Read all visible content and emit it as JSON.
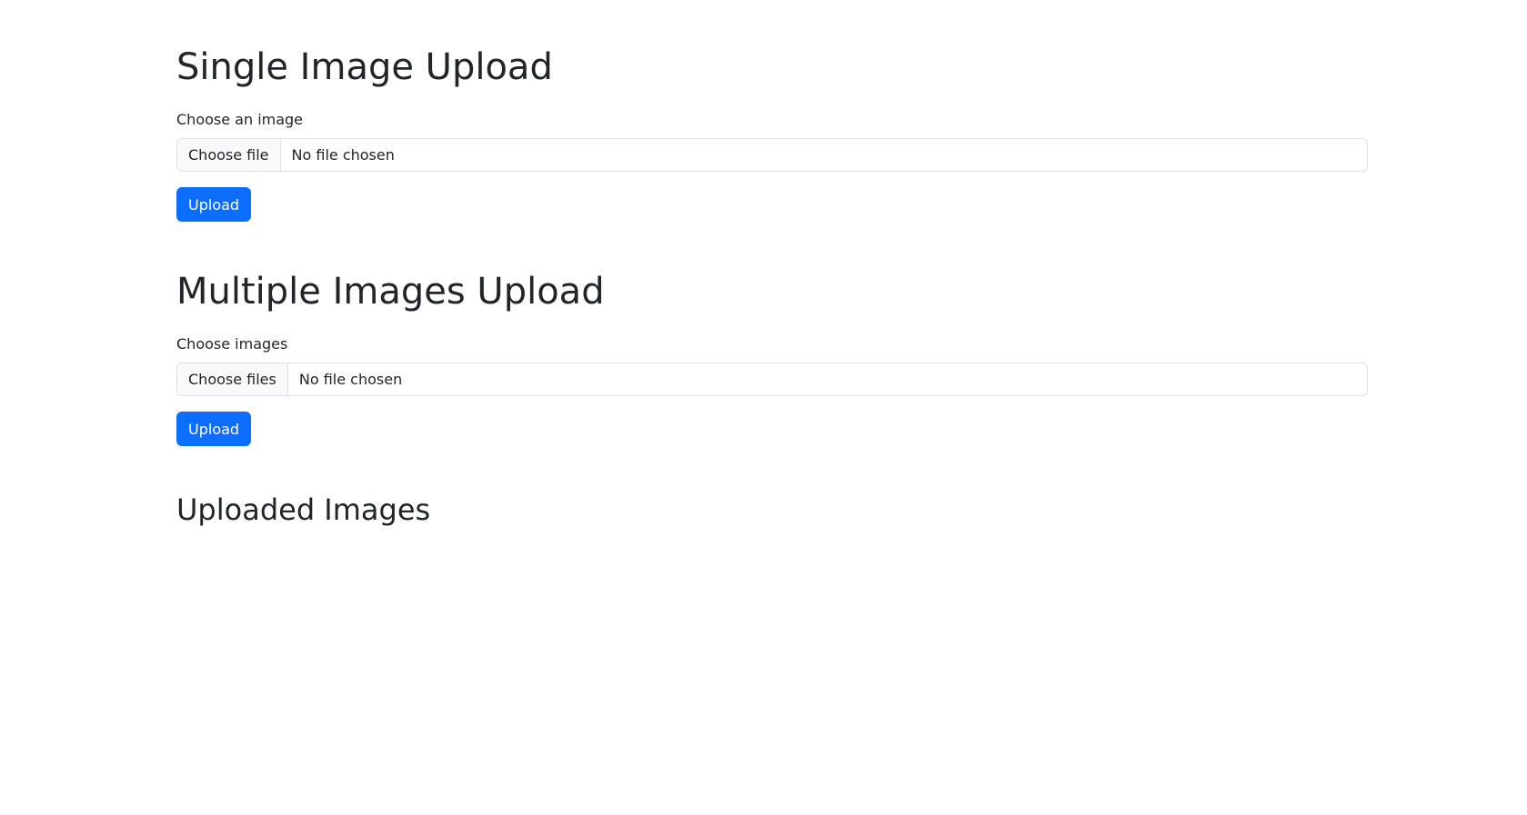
{
  "single": {
    "title": "Single Image Upload",
    "label": "Choose an image",
    "file_button": "Choose file",
    "file_status": "No file chosen",
    "upload_button": "Upload"
  },
  "multiple": {
    "title": "Multiple Images Upload",
    "label": "Choose images",
    "file_button": "Choose files",
    "file_status": "No file chosen",
    "upload_button": "Upload"
  },
  "uploaded": {
    "title": "Uploaded Images"
  },
  "colors": {
    "primary": "#0d6efd",
    "text": "#212529",
    "border": "#dee2e6",
    "file_button_bg": "#f8f9fa"
  }
}
